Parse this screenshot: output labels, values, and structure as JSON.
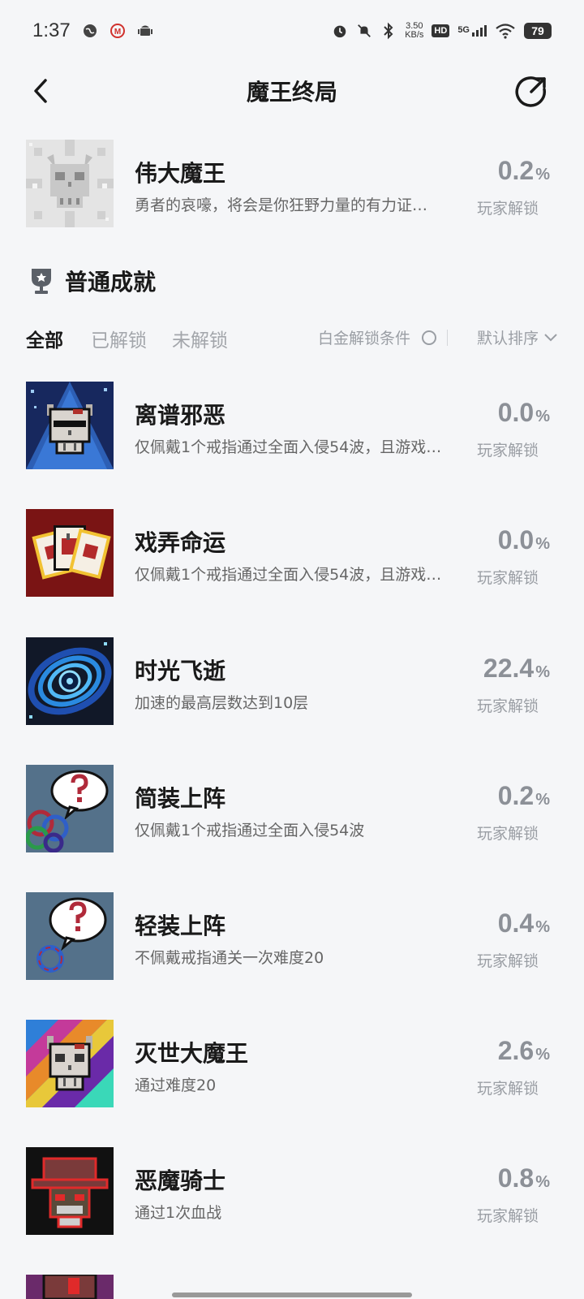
{
  "status_bar": {
    "time": "1:37",
    "speed_value": "3.50",
    "speed_unit": "KB/s",
    "network": "5G",
    "hd": "HD",
    "battery": "79"
  },
  "header": {
    "title": "魔王终局",
    "back_icon": "chevron-left-icon",
    "share_icon": "share-icon"
  },
  "featured": {
    "name": "伟大魔王",
    "desc": "勇者的哀嚎，将会是你狂野力量的有力证…",
    "pct": "0.2",
    "unit": "%",
    "label": "玩家解锁"
  },
  "section": {
    "title": "普通成就",
    "icon": "trophy-icon"
  },
  "filters": {
    "tabs": [
      "全部",
      "已解锁",
      "未解锁"
    ],
    "active_tab": "全部",
    "platinum_label": "白金解锁条件",
    "sort_label": "默认排序"
  },
  "achievements": [
    {
      "name": "离谱邪恶",
      "desc": "仅佩戴1个戒指通过全面入侵54波，且游戏…",
      "pct": "0.0",
      "unit": "%",
      "label": "玩家解锁"
    },
    {
      "name": "戏弄命运",
      "desc": "仅佩戴1个戒指通过全面入侵54波，且游戏…",
      "pct": "0.0",
      "unit": "%",
      "label": "玩家解锁"
    },
    {
      "name": "时光飞逝",
      "desc": "加速的最高层数达到10层",
      "pct": "22.4",
      "unit": "%",
      "label": "玩家解锁"
    },
    {
      "name": "简装上阵",
      "desc": "仅佩戴1个戒指通过全面入侵54波",
      "pct": "0.2",
      "unit": "%",
      "label": "玩家解锁"
    },
    {
      "name": "轻装上阵",
      "desc": "不佩戴戒指通关一次难度20",
      "pct": "0.4",
      "unit": "%",
      "label": "玩家解锁"
    },
    {
      "name": "灭世大魔王",
      "desc": "通过难度20",
      "pct": "2.6",
      "unit": "%",
      "label": "玩家解锁"
    },
    {
      "name": "恶魔骑士",
      "desc": "通过1次血战",
      "pct": "0.8",
      "unit": "%",
      "label": "玩家解锁"
    }
  ]
}
